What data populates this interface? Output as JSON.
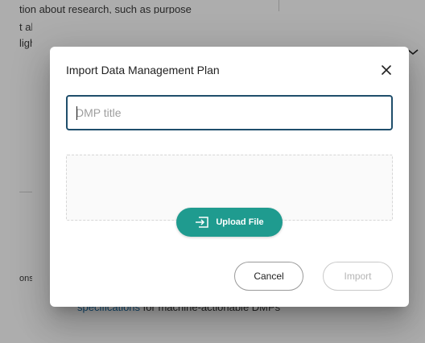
{
  "background": {
    "line1": "tion about research, such as purpose",
    "line2": "t al",
    "line3": "ligh",
    "line4": "ons",
    "link_text": "specifications",
    "link_trailing": " for machine-actionable DMPs"
  },
  "dialog": {
    "title": "Import Data Management Plan",
    "title_placeholder": "DMP title",
    "title_value": "",
    "upload_label": "Upload File",
    "cancel_label": "Cancel",
    "import_label": "Import",
    "import_enabled": false
  },
  "icons": {
    "close": "close-icon",
    "upload": "upload-file-icon",
    "outer_collapse": "chevron-down-icon"
  },
  "colors": {
    "accent": "#1f9b8f",
    "input_border": "#1f4e6b",
    "disabled_text": "#b5b5b5",
    "link": "#1b6fa8"
  }
}
